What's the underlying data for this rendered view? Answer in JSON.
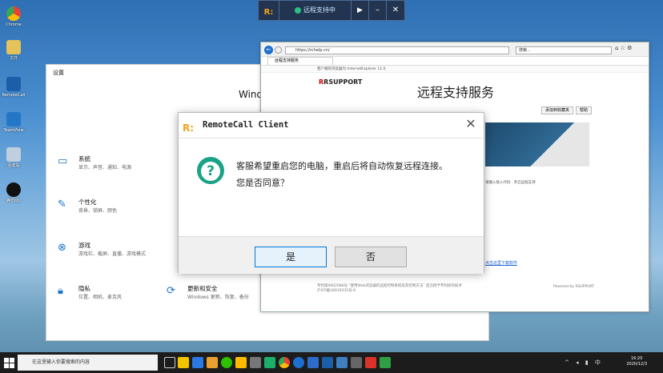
{
  "desktop": {
    "icons": [
      {
        "label": "Chrome",
        "color": "#e94235"
      },
      {
        "label": "文件",
        "color": "#e3c35a"
      },
      {
        "label": "RemoteCall",
        "color": "#1a5fa8"
      },
      {
        "label": "TeamView",
        "color": "#2477c7"
      },
      {
        "label": "回收站",
        "color": "#bfcfe0"
      },
      {
        "label": "腾讯QQ",
        "color": "#111111"
      }
    ]
  },
  "settings": {
    "title": "设置",
    "brand": "Windo",
    "categories": [
      {
        "name": "系统",
        "desc": "显示、声音、通知、电源",
        "icon": "laptop-icon"
      },
      {
        "name": "个性化",
        "desc": "背景、锁屏、颜色",
        "icon": "brush-icon"
      },
      {
        "name": "游戏",
        "desc": "游戏栏、截屏、直播、游戏模式",
        "icon": "xbox-icon"
      },
      {
        "name": "隐私",
        "desc": "位置、相机、麦克风",
        "icon": "lock-icon"
      },
      {
        "name": "更新和安全",
        "desc": "Windows 更新、恢复、备份",
        "icon": "sync-icon"
      }
    ]
  },
  "remote_toolbar": {
    "status": "远程支持中",
    "play": "▶",
    "minimize": "–",
    "close": "✕"
  },
  "browser": {
    "url": "https://rchelp.cn/",
    "search_placeholder": "搜索...",
    "tab": "远程支持服务",
    "info_bar": "客户端的浏览器为 InternetExplorer 11.0",
    "logo": "RSUPPORT",
    "page_title": "远程支持服务",
    "buttons": [
      "添加到收藏夹",
      "帮助"
    ],
    "text_snippet": "请输入接入代码 · 开启远程支持",
    "link": "点击这里下载软件",
    "footer": "专利第0602086号 \"使用Web浏览器的远程控制系统及其控制方法\" 是已授予专利权的技术",
    "footer2": "沪ICP备18019335号-6",
    "powered": "Powered by RSUPPORT"
  },
  "dialog": {
    "title": "RemoteCall Client",
    "message_line1": "客服希望重启您的电脑，重启后将自动恢复远程连接。",
    "message_line2": "您是否同意？",
    "yes": "是",
    "no": "否",
    "accent": "#1aa286"
  },
  "taskbar": {
    "search_placeholder": "在这里输入你要搜索的内容",
    "time": "16:20",
    "date": "2020/12/3"
  }
}
